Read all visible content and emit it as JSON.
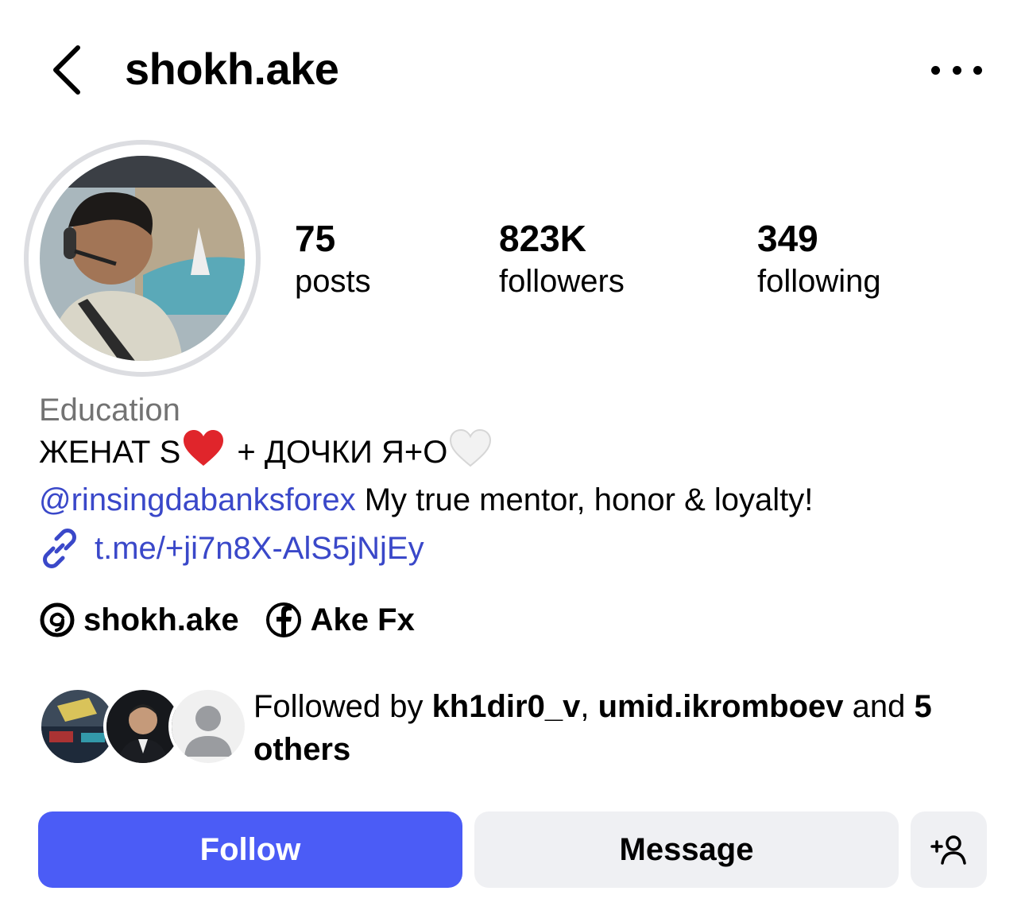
{
  "header": {
    "back_icon": "chevron-left-icon",
    "username": "shokh.ake",
    "more_icon": "more-horizontal-icon"
  },
  "profile": {
    "stats": {
      "posts_value": "75",
      "posts_label": "posts",
      "followers_value": "823K",
      "followers_label": "followers",
      "following_value": "349",
      "following_label": "following"
    },
    "category": "Education",
    "bio_line1_a": "ЖЕНАТ S",
    "bio_line1_b": " + ДОЧКИ Я+О",
    "bio_mention": "@rinsingdabanksforex",
    "bio_line2_rest": " My true mentor, honor & loyalty!",
    "link": "t.me/+ji7n8X-AlS5jNjEy",
    "threads_handle": "shokh.ake",
    "facebook_name": "Ake Fx"
  },
  "followed_by": {
    "prefix": "Followed by ",
    "user1": "kh1dir0_v",
    "sep": ", ",
    "user2": "umid.ikromboev",
    "and": " and ",
    "others": "5 others"
  },
  "actions": {
    "follow_label": "Follow",
    "message_label": "Message",
    "add_user_icon": "add-user-icon"
  },
  "colors": {
    "accent": "#4b5cf6",
    "link": "#3a48c9",
    "secondary_btn": "#eff0f3",
    "muted_text": "#737373"
  }
}
